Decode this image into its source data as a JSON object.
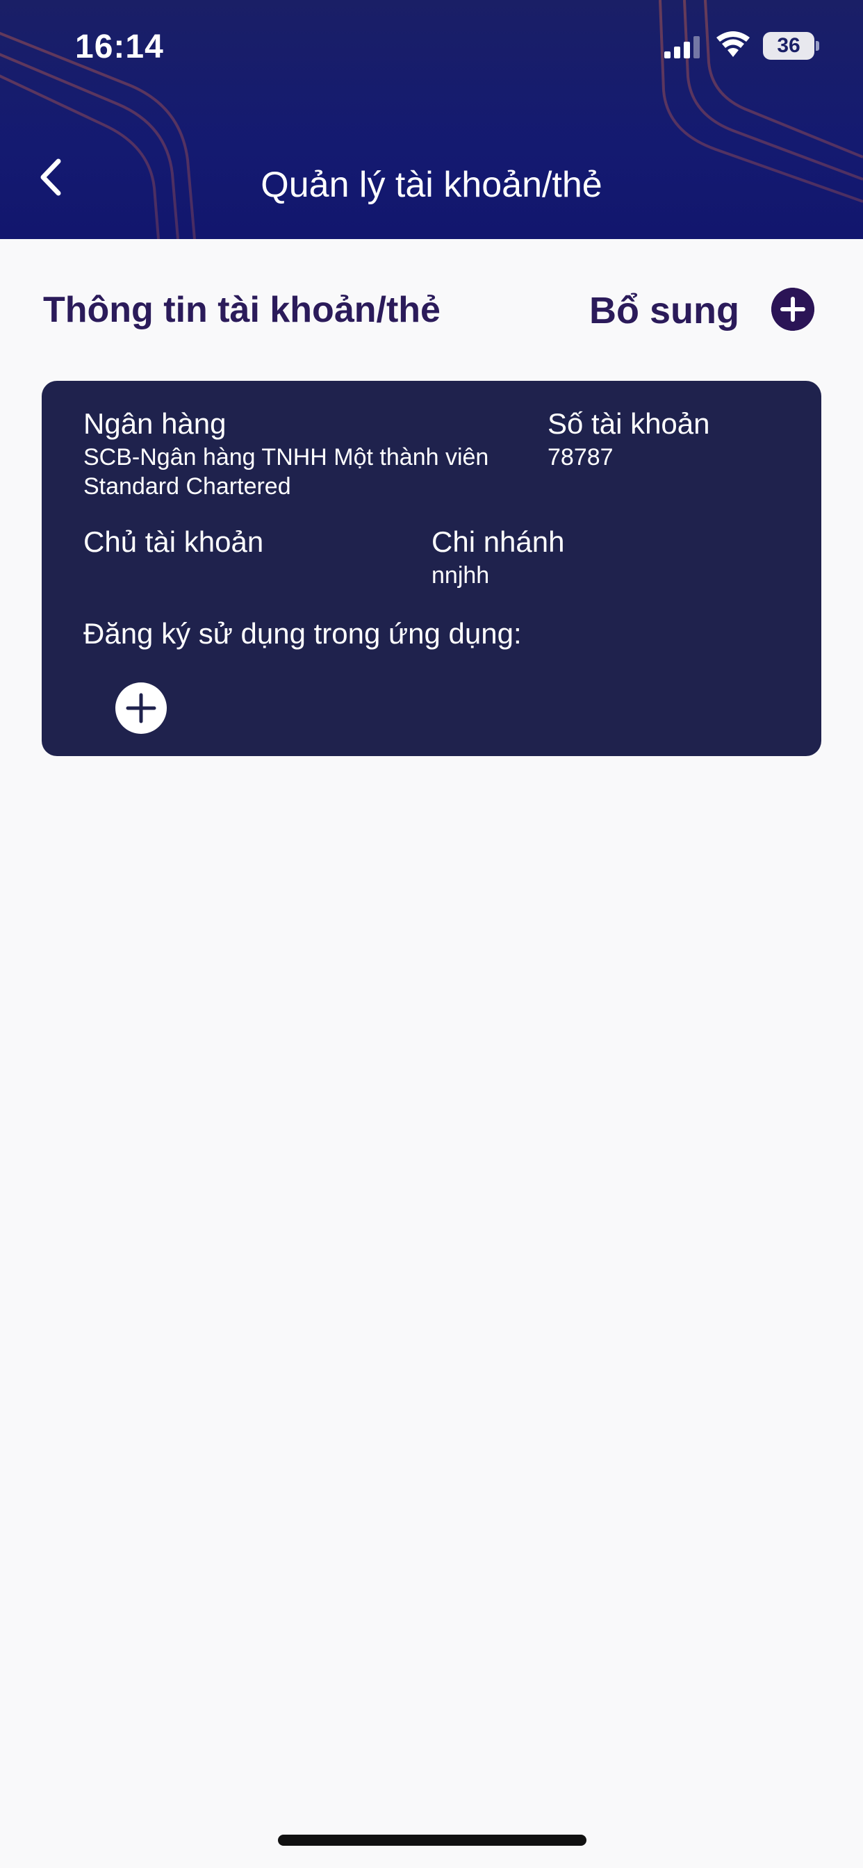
{
  "status_bar": {
    "time": "16:14",
    "battery": "36"
  },
  "header": {
    "title": "Quản lý tài khoản/thẻ"
  },
  "section": {
    "title": "Thông tin tài khoản/thẻ",
    "add_label": "Bổ sung"
  },
  "account_card": {
    "bank_label": "Ngân hàng",
    "bank_value_line1": "SCB-Ngân hàng TNHH Một thành viên",
    "bank_value_line2": "Standard Chartered",
    "account_number_label": "Số tài khoản",
    "account_number_value": "78787",
    "holder_label": "Chủ tài khoản",
    "holder_value": "",
    "branch_label": "Chi nhánh",
    "branch_value": "nnjhh",
    "register_label": "Đăng ký sử dụng trong ứng dụng:"
  },
  "colors": {
    "header_bg": "#141a72",
    "card_bg": "#1f224d",
    "accent_text": "#2b1b5a",
    "page_bg": "#f9f9fa"
  }
}
